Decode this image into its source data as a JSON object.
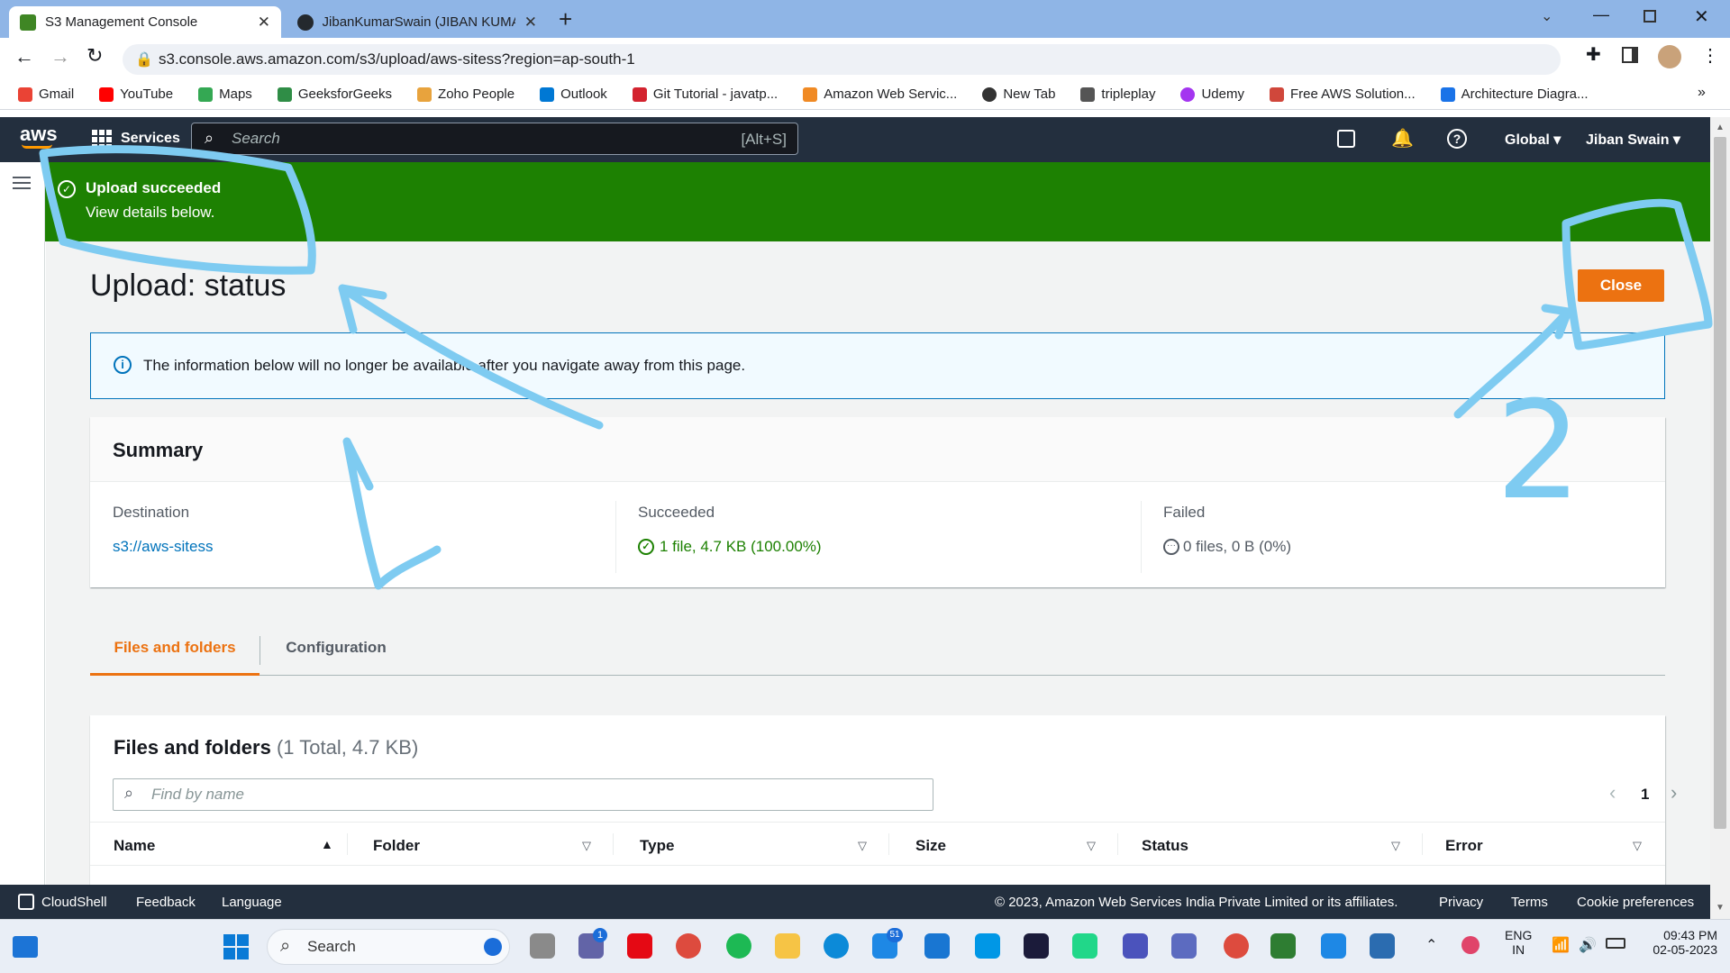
{
  "browser": {
    "tabs": [
      {
        "title": "S3 Management Console",
        "active": true
      },
      {
        "title": "JibanKumarSwain (JIBAN KUMAR",
        "active": false
      }
    ],
    "url": "s3.console.aws.amazon.com/s3/upload/aws-sitess?region=ap-south-1",
    "bookmarks": [
      "Gmail",
      "YouTube",
      "Maps",
      "GeeksforGeeks",
      "Zoho People",
      "Outlook",
      "Git Tutorial - javatp...",
      "Amazon Web Servic...",
      "New Tab",
      "tripleplay",
      "Udemy",
      "Free AWS Solution...",
      "Architecture Diagra..."
    ]
  },
  "aws_nav": {
    "logo": "aws",
    "services": "Services",
    "search_placeholder": "Search",
    "search_shortcut": "[Alt+S]",
    "region": "Global",
    "user": "Jiban Swain"
  },
  "flash": {
    "title": "Upload succeeded",
    "message": "View details below."
  },
  "page": {
    "title": "Upload: status",
    "close_label": "Close",
    "info": "The information below will no longer be available after you navigate away from this page."
  },
  "summary": {
    "heading": "Summary",
    "destination_label": "Destination",
    "destination_value": "s3://aws-sitess",
    "succeeded_label": "Succeeded",
    "succeeded_value": "1 file, 4.7 KB (100.00%)",
    "failed_label": "Failed",
    "failed_value": "0 files, 0 B (0%)"
  },
  "tabs": [
    "Files and folders",
    "Configuration"
  ],
  "files": {
    "heading": "Files and folders",
    "count": "(1 Total, 4.7 KB)",
    "find_placeholder": "Find by name",
    "page": "1",
    "columns": [
      "Name",
      "Folder",
      "Type",
      "Size",
      "Status",
      "Error"
    ]
  },
  "footer": {
    "cloudshell": "CloudShell",
    "feedback": "Feedback",
    "language": "Language",
    "copyright": "© 2023, Amazon Web Services India Private Limited or its affiliates.",
    "privacy": "Privacy",
    "terms": "Terms",
    "cookies": "Cookie preferences"
  },
  "taskbar": {
    "search": "Search",
    "lang1": "ENG",
    "lang2": "IN",
    "time": "09:43 PM",
    "date": "02-05-2023",
    "teams_badge": "1",
    "mail_badge": "51"
  },
  "annotation_number": "2",
  "colors": {
    "aws_nav": "#232f3e",
    "success_green": "#1d8102",
    "aws_orange": "#ec7211",
    "annotation": "#7ecbf1",
    "link": "#0073bb"
  }
}
